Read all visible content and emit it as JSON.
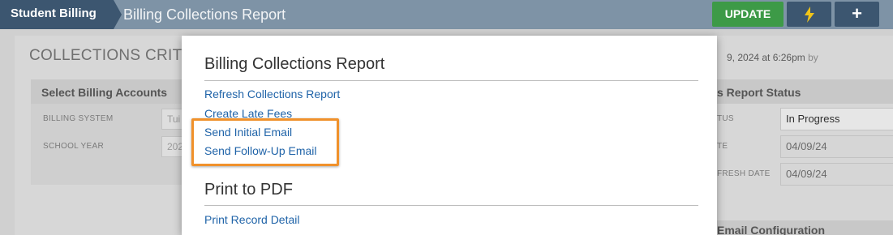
{
  "topbar": {
    "module": "Student Billing",
    "title": "Billing Collections Report",
    "update_label": "UPDATE",
    "bolt_icon": "lightning-icon",
    "plus_icon": "plus-icon"
  },
  "page": {
    "section_title": "COLLECTIONS CRITERIA",
    "meta_date": "9, 2024 at 6:26pm",
    "meta_by": "by",
    "left_panel": {
      "heading": "Select Billing Accounts",
      "fields": [
        {
          "label": "BILLING SYSTEM",
          "value": "Tui"
        },
        {
          "label": "SCHOOL YEAR",
          "value": "202"
        }
      ]
    },
    "right_panel": {
      "heading": "s Report Status",
      "fields": [
        {
          "label": "TUS",
          "value": "In Progress"
        },
        {
          "label": "TE",
          "value": "04/09/24"
        },
        {
          "label": "FRESH DATE",
          "value": "04/09/24"
        }
      ]
    },
    "bottom_panel": {
      "heading": "Email Configuration"
    }
  },
  "dropdown": {
    "section1": {
      "heading": "Billing Collections Report",
      "links": [
        "Refresh Collections Report",
        "Create Late Fees",
        "Send Initial Email",
        "Send Follow-Up Email"
      ]
    },
    "section2": {
      "heading": "Print to PDF",
      "links": [
        "Print Record Detail"
      ]
    }
  },
  "colors": {
    "topbar": "#7e93a6",
    "module_tab": "#3c5670",
    "update_button": "#3d9a47",
    "link": "#1f63a8",
    "highlight": "#f0912b"
  }
}
